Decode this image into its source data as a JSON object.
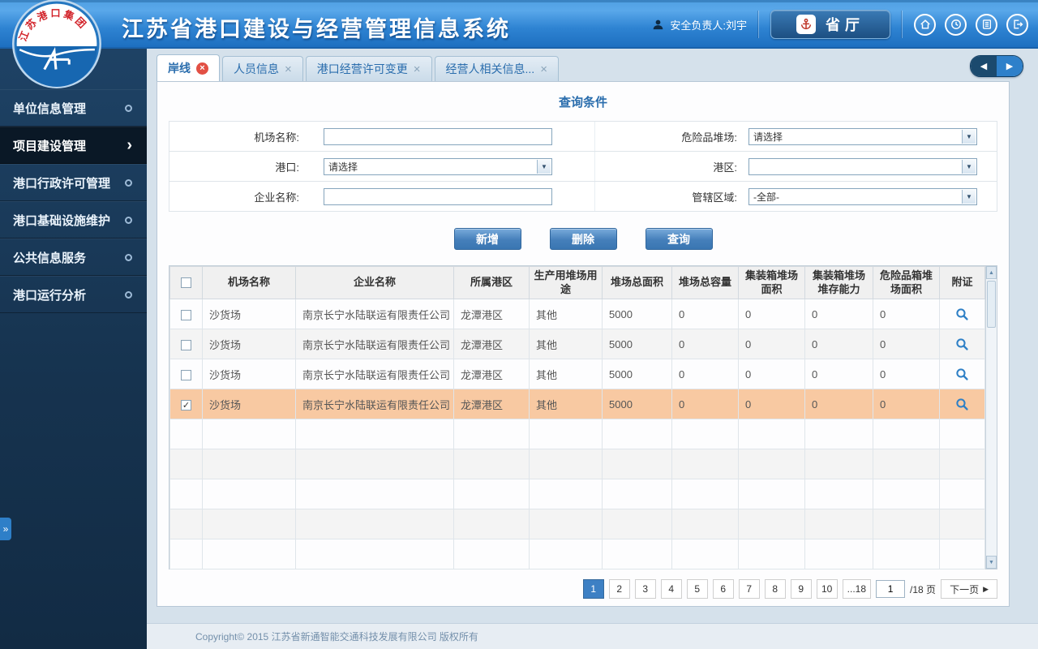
{
  "header": {
    "title": "江苏省港口建设与经营管理信息系统",
    "user_label": "安全负责人:刘宇",
    "province_button_label": "省厅",
    "icons": [
      "person-icon",
      "anchor-icon",
      "home-icon",
      "clock-icon",
      "document-icon",
      "logout-icon"
    ],
    "colors": {
      "header_blue": "#2e83d2",
      "button_navy": "#1c4f82"
    }
  },
  "sidebar": {
    "items": [
      {
        "label": "单位信息管理",
        "active": false
      },
      {
        "label": "项目建设管理",
        "active": true
      },
      {
        "label": "港口行政许可管理",
        "active": false
      },
      {
        "label": "港口基础设施维护",
        "active": false
      },
      {
        "label": "公共信息服务",
        "active": false
      },
      {
        "label": "港口运行分析",
        "active": false
      }
    ],
    "expander_glyph": "»"
  },
  "tabs": {
    "items": [
      {
        "label": "岸线",
        "active": true
      },
      {
        "label": "人员信息",
        "active": false
      },
      {
        "label": "港口经营许可变更",
        "active": false
      },
      {
        "label": "经营人相关信息...",
        "active": false
      }
    ],
    "prev": "◀",
    "next": "▶"
  },
  "query": {
    "title": "查询条件",
    "rows": [
      {
        "label1": "机场名称:",
        "field1": {
          "type": "input",
          "value": ""
        },
        "label2": "危险品堆场:",
        "field2": {
          "type": "select",
          "value": "请选择"
        }
      },
      {
        "label1": "港口:",
        "field1": {
          "type": "select",
          "value": "请选择"
        },
        "label2": "港区:",
        "field2": {
          "type": "select",
          "value": ""
        }
      },
      {
        "label1": "企业名称:",
        "field1": {
          "type": "input",
          "value": ""
        },
        "label2": "管辖区域:",
        "field2": {
          "type": "select",
          "value": "-全部-"
        }
      }
    ],
    "buttons": [
      {
        "label": "新增"
      },
      {
        "label": "删除"
      },
      {
        "label": "查询"
      }
    ]
  },
  "table": {
    "headers": [
      "机场名称",
      "企业名称",
      "所属港区",
      "生产用堆场用途",
      "堆场总面积",
      "堆场总容量",
      "集装箱堆场面积",
      "集装箱堆场堆存能力",
      "危险品箱堆场面积",
      "附证"
    ],
    "rows": [
      {
        "checked": false,
        "selected": false,
        "cells": [
          "沙货场",
          "南京长宁水陆联运有限责任公司",
          "龙潭港区",
          "其他",
          "5000",
          "0",
          "0",
          "0",
          "0"
        ]
      },
      {
        "checked": false,
        "selected": false,
        "cells": [
          "沙货场",
          "南京长宁水陆联运有限责任公司",
          "龙潭港区",
          "其他",
          "5000",
          "0",
          "0",
          "0",
          "0"
        ]
      },
      {
        "checked": false,
        "selected": false,
        "cells": [
          "沙货场",
          "南京长宁水陆联运有限责任公司",
          "龙潭港区",
          "其他",
          "5000",
          "0",
          "0",
          "0",
          "0"
        ]
      },
      {
        "checked": true,
        "selected": true,
        "cells": [
          "沙货场",
          "南京长宁水陆联运有限责任公司",
          "龙潭港区",
          "其他",
          "5000",
          "0",
          "0",
          "0",
          "0"
        ]
      }
    ],
    "empty_rows": 5,
    "selected_row_color": "#f8c9a2"
  },
  "pagination": {
    "pages": [
      "1",
      "2",
      "3",
      "4",
      "5",
      "6",
      "7",
      "8",
      "9",
      "10",
      "...18"
    ],
    "current": "1",
    "page_input_value": "1",
    "total_label": "/18 页",
    "next_label": "下一页"
  },
  "footer": {
    "copyright": "Copyright©  2015  江苏省新通智能交通科技发展有限公司  版权所有"
  }
}
